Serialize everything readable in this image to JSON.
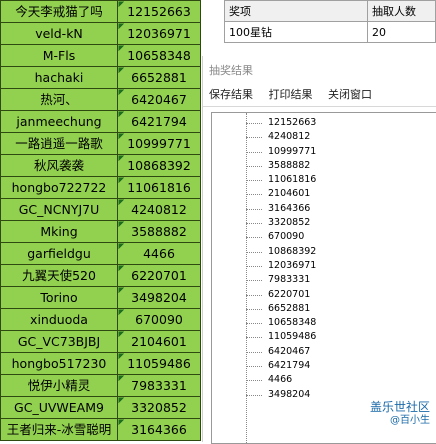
{
  "sheet": {
    "rows": [
      {
        "name": "今天李戒猫了吗",
        "num": "12152663"
      },
      {
        "name": "veld-kN",
        "num": "12036971"
      },
      {
        "name": "M-Fls",
        "num": "10658348"
      },
      {
        "name": "hachaki",
        "num": "6652881"
      },
      {
        "name": "热河、",
        "num": "6420467"
      },
      {
        "name": "janmeechung",
        "num": "6421794"
      },
      {
        "name": "一路逍遥一路歌",
        "num": "10999771"
      },
      {
        "name": "秋风袭袭",
        "num": "10868392"
      },
      {
        "name": "hongbo722722",
        "num": "11061816"
      },
      {
        "name": "GC_NCNYJ7U",
        "num": "4240812"
      },
      {
        "name": "Mking",
        "num": "3588882"
      },
      {
        "name": "garfieldgu",
        "num": "4466"
      },
      {
        "name": "九翼天使520",
        "num": "6220701"
      },
      {
        "name": "Torino",
        "num": "3498204"
      },
      {
        "name": "xinduoda",
        "num": "670090"
      },
      {
        "name": "GC_VC73BJBJ",
        "num": "2104601"
      },
      {
        "name": "hongbo517230",
        "num": "11059486"
      },
      {
        "name": "悦伊小精灵",
        "num": "7983331"
      },
      {
        "name": "GC_UVWEAM9",
        "num": "3320852"
      },
      {
        "name": "王者归来-冰雪聪明",
        "num": "3164366"
      }
    ]
  },
  "prize": {
    "headers": [
      "奖项",
      "抽取人数"
    ],
    "row": [
      "100星钻",
      "20"
    ]
  },
  "dialog": {
    "title": "抽奖结果",
    "menu": [
      "保存结果",
      "打印结果",
      "关闭窗口"
    ],
    "results": [
      "12152663",
      "4240812",
      "10999771",
      "3588882",
      "11061816",
      "2104601",
      "3164366",
      "3320852",
      "670090",
      "10868392",
      "12036971",
      "7983331",
      "6220701",
      "6652881",
      "10658348",
      "11059486",
      "6420467",
      "6421794",
      "4466",
      "3498204"
    ]
  },
  "watermark": {
    "main": "盖乐世社区",
    "sub": "@百小生"
  }
}
